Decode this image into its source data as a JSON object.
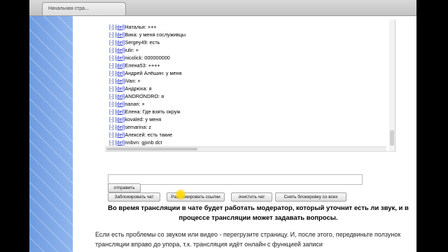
{
  "browser": {
    "tab_title": "Начальная стра..."
  },
  "chat": {
    "messages": [
      {
        "remove": "[-]",
        "del": "[del]",
        "text": "Наталья: +++"
      },
      {
        "remove": "[-]",
        "del": "[del]",
        "text": "Вика: у меня сослуживцы"
      },
      {
        "remove": "[-]",
        "del": "[del]",
        "text": "Sergey49: есть"
      },
      {
        "remove": "[-]",
        "del": "[del]",
        "text": "iulir: +"
      },
      {
        "remove": "[-]",
        "del": "[del]",
        "text": "nicolick: 000000000"
      },
      {
        "remove": "[-]",
        "del": "[del]",
        "text": "Елена53: ++++"
      },
      {
        "remove": "[-]",
        "del": "[del]",
        "text": "Андрей Алёшин: у меня"
      },
      {
        "remove": "[-]",
        "del": "[del]",
        "text": "iVan: +"
      },
      {
        "remove": "[-]",
        "del": "[del]",
        "text": "Андрюха: я"
      },
      {
        "remove": "[-]",
        "del": "[del]",
        "text": "ANDRONDRO: я"
      },
      {
        "remove": "[-]",
        "del": "[del]",
        "text": "nanan: +"
      },
      {
        "remove": "[-]",
        "del": "[del]",
        "text": "Елена: Где взять окруж"
      },
      {
        "remove": "[-]",
        "del": "[del]",
        "text": "kovaled: у меня"
      },
      {
        "remove": "[-]",
        "del": "[del]",
        "text": "semarina: z"
      },
      {
        "remove": "[-]",
        "del": "[del]",
        "text": "Алексей: есть такие"
      },
      {
        "remove": "[-]",
        "del": "[del]",
        "text": "nnbvn: gjxnb dct"
      }
    ]
  },
  "buttons": {
    "send": "отправить",
    "block": "Заблокировать чат",
    "unblock_links": "Разблокировать ссылки",
    "clear_chat": "очистить чат",
    "remove_block_all": "Снять блокировку со всех"
  },
  "notice": "Во время трансляции в чате будет работать модератор, который уточнит есть ли звук, и в процессе трансляции может задавать вопросы.",
  "paragraph": "Если есть проблемы со звуком или видео - перегрузите страницу. И, после этого, передвиньте ползунок трансляции вправо до упора, т.к. трансляция идёт онлайн с функцией записи"
}
